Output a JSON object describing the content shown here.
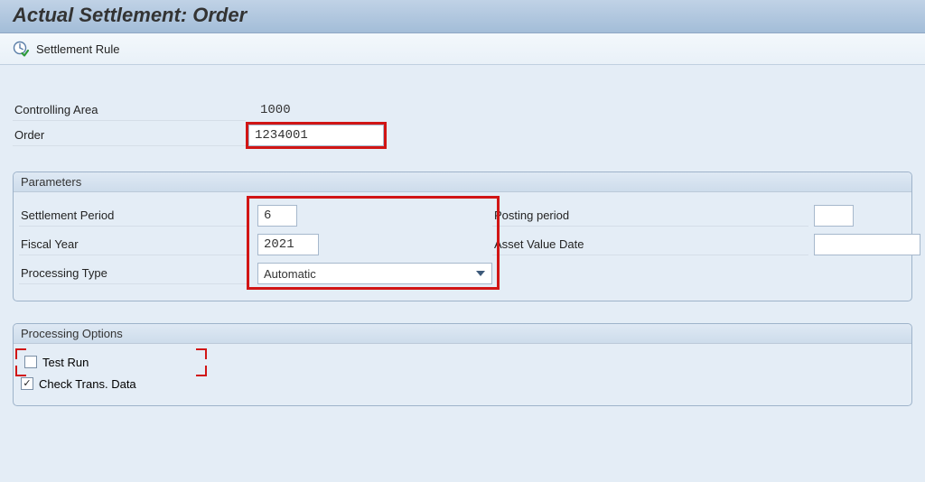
{
  "title": "Actual Settlement: Order",
  "toolbar": {
    "settlement_rule_label": "Settlement Rule"
  },
  "top_fields": {
    "controlling_area_label": "Controlling Area",
    "controlling_area_value": "1000",
    "order_label": "Order",
    "order_value": "1234001"
  },
  "parameters": {
    "header": "Parameters",
    "settlement_period_label": "Settlement Period",
    "settlement_period_value": "6",
    "fiscal_year_label": "Fiscal Year",
    "fiscal_year_value": "2021",
    "processing_type_label": "Processing Type",
    "processing_type_value": "Automatic",
    "posting_period_label": "Posting period",
    "posting_period_value": "",
    "asset_value_date_label": "Asset Value Date",
    "asset_value_date_value": ""
  },
  "processing_options": {
    "header": "Processing Options",
    "test_run_label": "Test Run",
    "test_run_checked": false,
    "check_trans_data_label": "Check Trans. Data",
    "check_trans_data_checked": true
  }
}
